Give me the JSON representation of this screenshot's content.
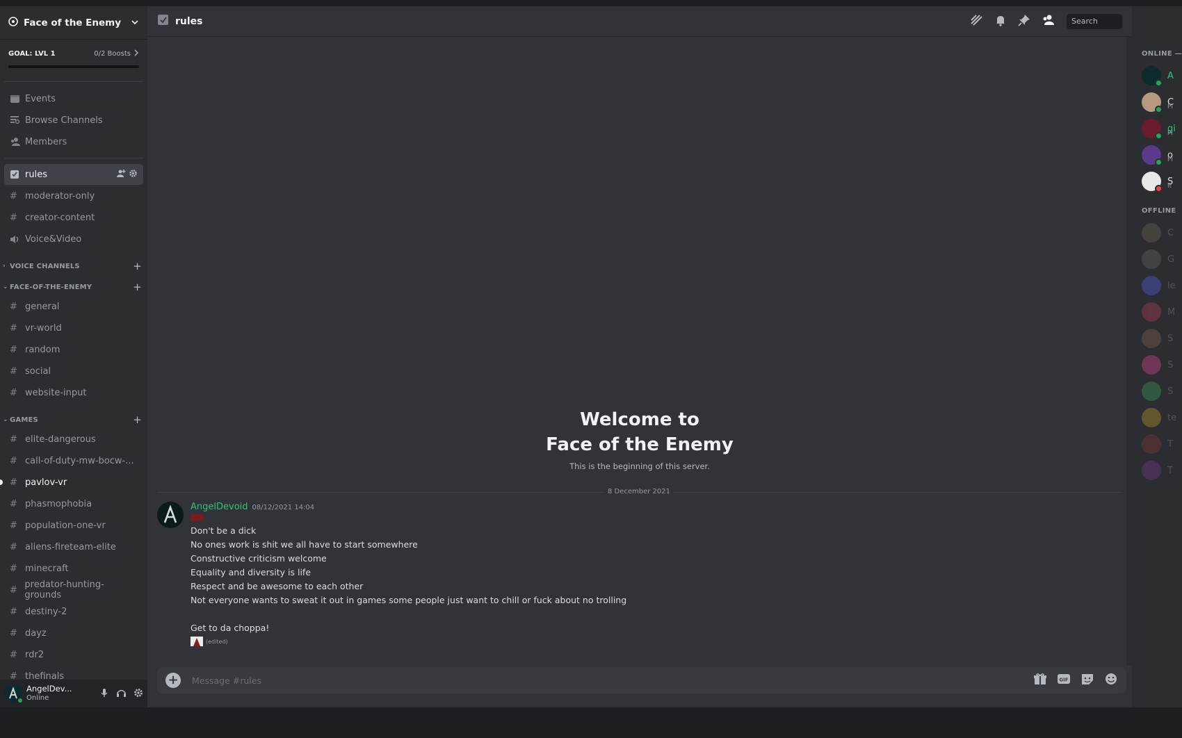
{
  "server": {
    "name": "Face of the Enemy"
  },
  "goal": {
    "label": "GOAL: LVL 1",
    "boosts": "0/2 Boosts"
  },
  "nav": [
    {
      "label": "Events",
      "icon": "calendar-icon"
    },
    {
      "label": "Browse Channels",
      "icon": "browse-channels-icon"
    },
    {
      "label": "Members",
      "icon": "members-icon"
    }
  ],
  "top_channels": [
    {
      "label": "rules",
      "icon": "rules-icon",
      "active": true
    },
    {
      "label": "moderator-only",
      "icon": "hash-icon"
    },
    {
      "label": "creator-content",
      "icon": "hash-icon"
    },
    {
      "label": "Voice&Video",
      "icon": "speaker-icon"
    }
  ],
  "categories": {
    "voice": {
      "label": "VOICE CHANNELS"
    },
    "face": {
      "label": "FACE-OF-THE-ENEMY",
      "channels": [
        "general",
        "vr-world",
        "random",
        "social",
        "website-input"
      ]
    },
    "games": {
      "label": "GAMES",
      "channels": [
        "elite-dangerous",
        "call-of-duty-mw-bocw-...",
        "pavlov-vr",
        "phasmophobia",
        "population-one-vr",
        "aliens-fireteam-elite",
        "minecraft",
        "predator-hunting-grounds",
        "destiny-2",
        "dayz",
        "rdr2",
        "thefinals"
      ]
    }
  },
  "user": {
    "name": "AngelDev...",
    "status": "Online"
  },
  "header": {
    "channel": "rules",
    "search_placeholder": "Search"
  },
  "welcome": {
    "line1": "Welcome to",
    "line2": "Face of the Enemy",
    "sub": "This is the beginning of this server."
  },
  "divider_date": "8 December 2021",
  "message": {
    "author": "AngelDevoid",
    "time": "08/12/2021 14:04",
    "lines": [
      "Don't be a dick",
      "No ones work is shit we all have to start somewhere",
      "Constructive criticism welcome",
      "Equality and diversity is life",
      "Respect and be awesome to each other",
      "Not everyone wants to sweat it out in games some people just want to chill or fuck about no trolling",
      "",
      "Get to da choppa!"
    ],
    "edited": "(edited)"
  },
  "composer": {
    "placeholder": "Message #rules"
  },
  "members": {
    "online_label": "ONLINE —",
    "offline_label": "OFFLINE",
    "online": [
      {
        "name": "A",
        "sub": "",
        "color": "#2dc770",
        "avatar": "#0d2a2e",
        "status": "online"
      },
      {
        "name": "C",
        "sub": "Pl",
        "color": "#dbdee1",
        "avatar": "#b59a80",
        "status": "online"
      },
      {
        "name": "gi",
        "sub": "Pl",
        "color": "#2dc770",
        "avatar": "#6b1c2b",
        "status": "online"
      },
      {
        "name": "o",
        "sub": "Pl",
        "color": "#dbdee1",
        "avatar": "#5a3a8a",
        "status": "online"
      },
      {
        "name": "S",
        "sub": "It",
        "color": "#dbdee1",
        "avatar": "#e8e8e8",
        "status": "dnd"
      }
    ],
    "offline": [
      {
        "name": "C",
        "avatar": "#7a6a5a"
      },
      {
        "name": "G",
        "avatar": "#6b6b6b"
      },
      {
        "name": "le",
        "avatar": "#5865f2"
      },
      {
        "name": "M",
        "avatar": "#c0405a"
      },
      {
        "name": "S",
        "avatar": "#8a6a4a"
      },
      {
        "name": "S",
        "avatar": "#eb459e"
      },
      {
        "name": "S",
        "avatar": "#3ba55c"
      },
      {
        "name": "te",
        "avatar": "#c9a227"
      },
      {
        "name": "T",
        "avatar": "#8a3a3a"
      },
      {
        "name": "T",
        "avatar": "#7a3a9a"
      }
    ]
  },
  "colors": {
    "accent_green": "#2dc770",
    "online": "#23a55a",
    "dnd": "#f23f43"
  }
}
